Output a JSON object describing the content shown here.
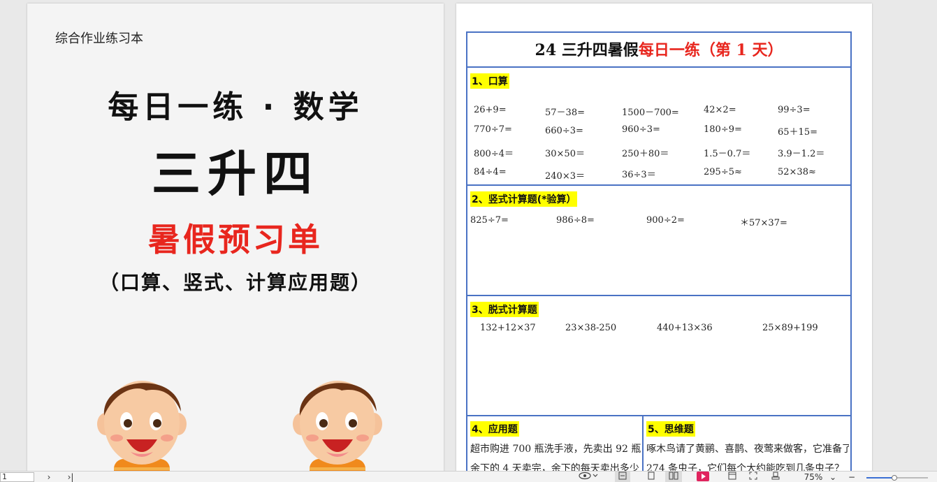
{
  "cover": {
    "small_title": "综合作业练习本",
    "line1": "每日一练 · 数学",
    "line2": "三升四",
    "line3": "暑假预习单",
    "line4": "（口算、竖式、计算应用题）"
  },
  "sheet": {
    "title_black": "24 三升四暑假",
    "title_red": "每日一练（第 1 天）",
    "s1": {
      "heading": "1、口算",
      "rows": [
        [
          "26+9=",
          "57－38=",
          "1500－700=",
          "42×2=",
          "99÷3="
        ],
        [
          "770÷7=",
          "660÷3=",
          "960÷3=",
          "180÷9=",
          "65＋15="
        ],
        [
          "800÷4＝",
          "30×50＝",
          "250＋80＝",
          "1.5－0.7＝",
          "3.9－1.2＝"
        ],
        [
          "84÷4=",
          "240×3＝",
          "36÷3＝",
          "295÷5≈",
          "52×38≈"
        ]
      ]
    },
    "s2": {
      "heading": "2、竖式计算题(*验算）",
      "items": [
        "825÷7=",
        "986÷8=",
        "900÷2=",
        "＊57×37="
      ]
    },
    "s3": {
      "heading": "3、脱式计算题",
      "items": [
        "132+12×37",
        "23×38-250",
        "440+13×36",
        "25×89+199"
      ]
    },
    "s4": {
      "heading": "4、应用题",
      "text1": "超市购进 700 瓶洗手液，先卖出 92 瓶，",
      "text2": "余下的 4 天卖完，余下的每天卖出多少"
    },
    "s5": {
      "heading": "5、思维题",
      "text1": "啄木鸟请了黄鹂、喜鹊、夜莺来做客，它准备了",
      "text2": "274 条虫子，它们每个大约能吃到几条虫子？"
    }
  },
  "status": {
    "page_value": "1",
    "zoom": "75%"
  },
  "colors": {
    "accent_red": "#e8261e",
    "border_blue": "#4a72c4",
    "highlight": "#ffff00"
  }
}
